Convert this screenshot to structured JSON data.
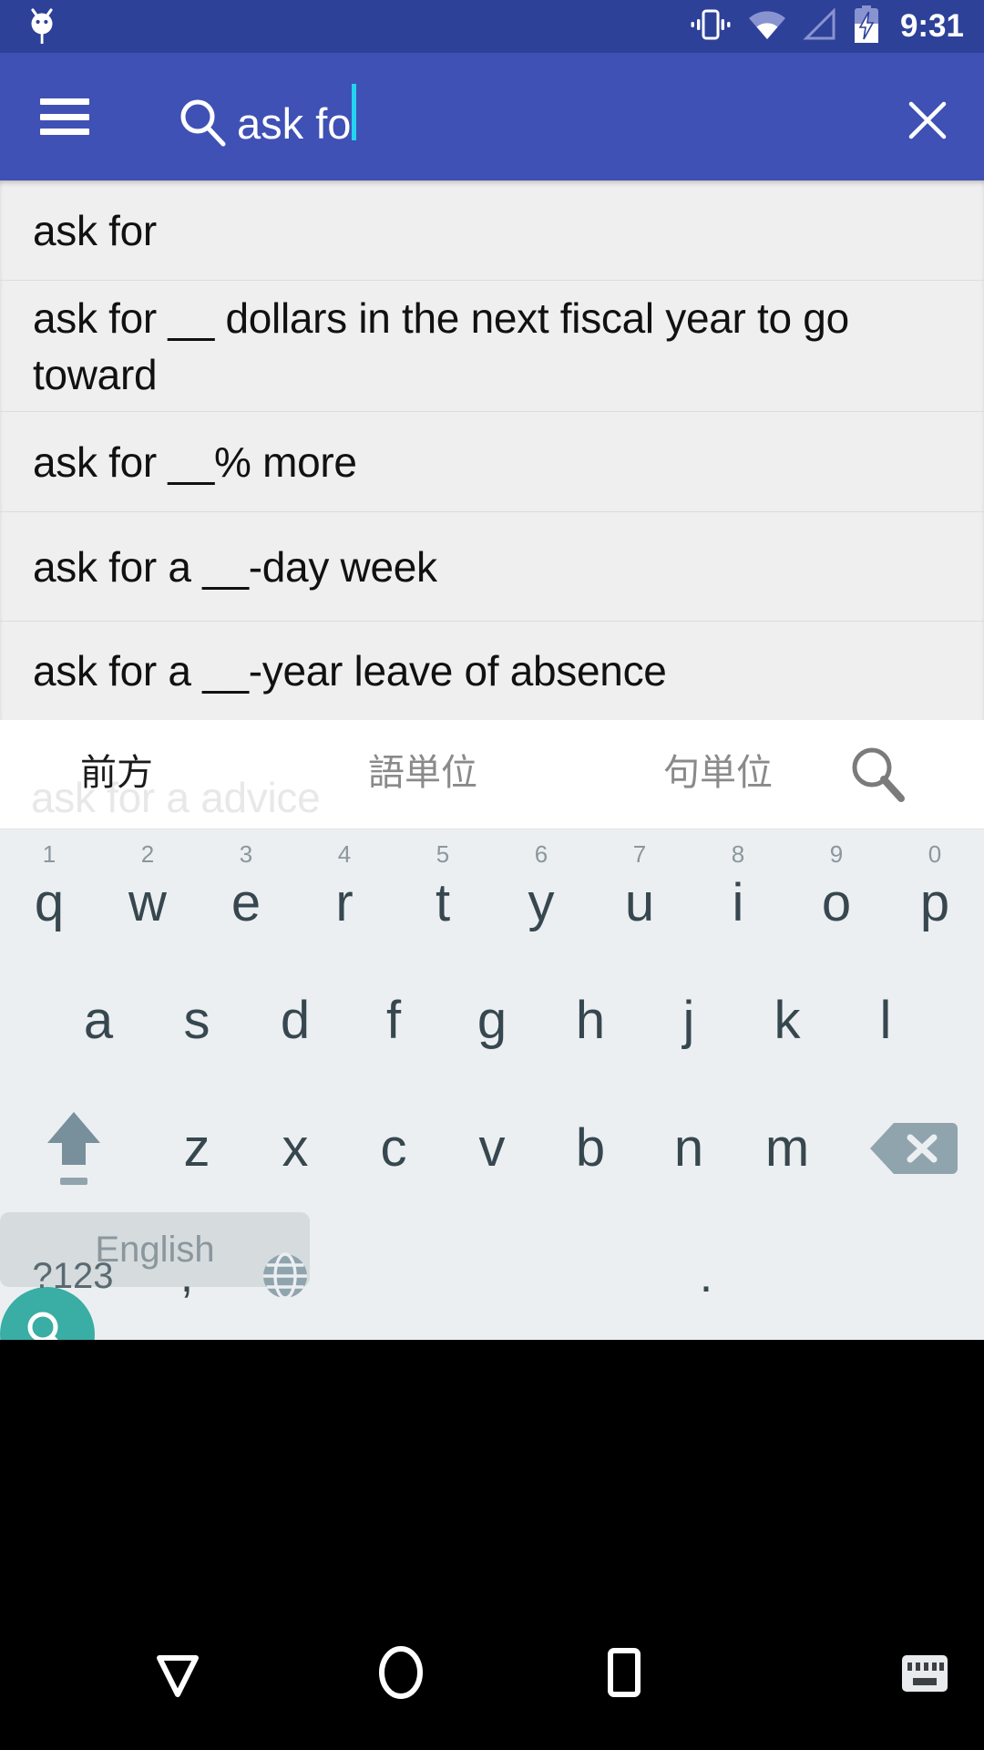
{
  "statusbar": {
    "notification_icon": "android-robot-icon",
    "icons": [
      "vibrate-icon",
      "wifi-icon",
      "signal-icon",
      "battery-charging-icon"
    ],
    "time": "9:31",
    "bg_color": "#2e4198"
  },
  "toolbar": {
    "bg_color": "#3f51b5",
    "menu_icon": "hamburger-menu-icon",
    "search_icon": "search-icon",
    "query_text": "ask fo",
    "caret_color": "#24d3f0",
    "clear_icon": "close-icon"
  },
  "suggestions": {
    "items": [
      {
        "text": "ask for"
      },
      {
        "text": "ask for __ dollars in the next fiscal year to go toward"
      },
      {
        "text": "ask for __% more"
      },
      {
        "text": "ask for a __-day week"
      },
      {
        "text": "ask for a __-year leave of absence"
      }
    ]
  },
  "candidate_strip": {
    "ghost_text": "ask for a advice",
    "options": [
      {
        "label": "前方",
        "active": true
      },
      {
        "label": "語単位",
        "active": false
      },
      {
        "label": "句単位",
        "active": false
      }
    ],
    "search_icon": "search-icon"
  },
  "keyboard": {
    "row1": [
      {
        "letter": "q",
        "num": "1"
      },
      {
        "letter": "w",
        "num": "2"
      },
      {
        "letter": "e",
        "num": "3"
      },
      {
        "letter": "r",
        "num": "4"
      },
      {
        "letter": "t",
        "num": "5"
      },
      {
        "letter": "y",
        "num": "6"
      },
      {
        "letter": "u",
        "num": "7"
      },
      {
        "letter": "i",
        "num": "8"
      },
      {
        "letter": "o",
        "num": "9"
      },
      {
        "letter": "p",
        "num": "0"
      }
    ],
    "row2": [
      {
        "letter": "a"
      },
      {
        "letter": "s"
      },
      {
        "letter": "d"
      },
      {
        "letter": "f"
      },
      {
        "letter": "g"
      },
      {
        "letter": "h"
      },
      {
        "letter": "j"
      },
      {
        "letter": "k"
      },
      {
        "letter": "l"
      }
    ],
    "row3": [
      {
        "letter": "z"
      },
      {
        "letter": "x"
      },
      {
        "letter": "c"
      },
      {
        "letter": "v"
      },
      {
        "letter": "b"
      },
      {
        "letter": "n"
      },
      {
        "letter": "m"
      }
    ],
    "shift_icon": "shift-arrow-icon",
    "delete_icon": "backspace-icon",
    "symbols_label": "?123",
    "comma_label": ",",
    "globe_icon": "language-globe-icon",
    "space_label": "English",
    "period_label": ".",
    "enter_icon": "search-icon",
    "enter_color": "#3aada4",
    "bg_color": "#eceff1",
    "key_color": "#37474f"
  },
  "navbar": {
    "back_icon": "back-triangle-icon",
    "home_icon": "home-circle-icon",
    "recents_icon": "recents-square-icon",
    "keyboard_icon": "keyboard-icon"
  }
}
